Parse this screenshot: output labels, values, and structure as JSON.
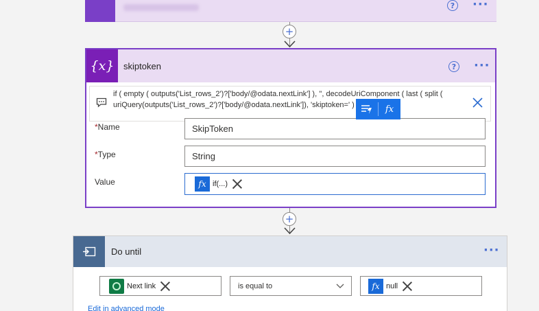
{
  "flow": {
    "top_card": {
      "help": "?"
    },
    "connector": {
      "plus": "+"
    },
    "variable_card": {
      "icon_text": "{x}",
      "title": "skiptoken",
      "help": "?",
      "expression": "if ( empty ( outputs('List_rows_2')?['body/@odata.nextLink'] ), '', decodeUriComponent ( last ( split ( uriQuery(outputs('List_rows_2')?['body/@odata.nextLink']), 'skiptoken=' ) ) ) )",
      "fields": {
        "name": {
          "label": "Name",
          "required": true,
          "value": "SkipToken"
        },
        "type": {
          "label": "Type",
          "required": true,
          "value": "String"
        },
        "value": {
          "label": "Value",
          "token_badge": "fx",
          "token_label": "if(...)"
        }
      },
      "fx_toolbar": {
        "fx_label": "fx"
      }
    },
    "do_until_card": {
      "title": "Do until",
      "condition": {
        "left_token": "Next link",
        "operator": "is equal to",
        "right_badge": "fx",
        "right_token": "null"
      },
      "advanced_link": "Edit in advanced mode"
    }
  },
  "colors": {
    "variable_accent": "#7a1fb6",
    "variable_header": "#eadcf3",
    "loop_accent": "#486991",
    "loop_header": "#e1e6ee",
    "link_blue": "#1a6ad8",
    "dataverse_green": "#0f7b45"
  }
}
